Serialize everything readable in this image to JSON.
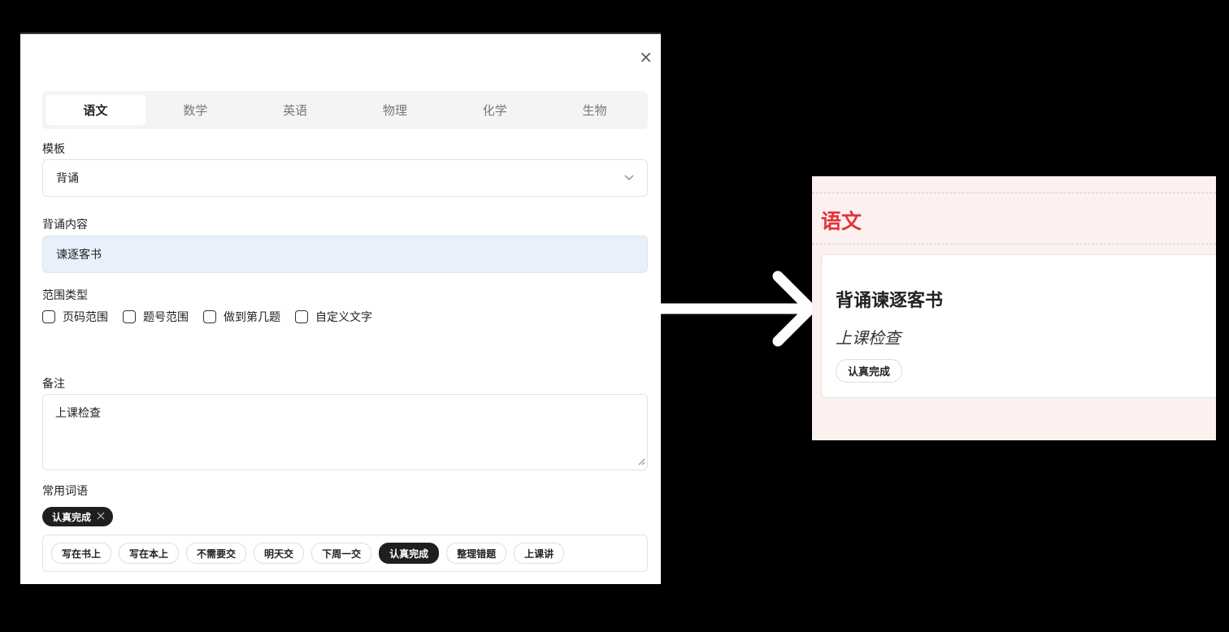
{
  "dialog": {
    "close_glyph": "×",
    "tabs": [
      {
        "label": "语文",
        "active": true
      },
      {
        "label": "数学",
        "active": false
      },
      {
        "label": "英语",
        "active": false
      },
      {
        "label": "物理",
        "active": false
      },
      {
        "label": "化学",
        "active": false
      },
      {
        "label": "生物",
        "active": false
      }
    ],
    "template_label": "模板",
    "template_value": "背诵",
    "content_label": "背诵内容",
    "content_value": "谏逐客书",
    "range_label": "范围类型",
    "range_options": [
      "页码范围",
      "题号范围",
      "做到第几题",
      "自定义文字"
    ],
    "note_label": "备注",
    "note_value": "上课检查",
    "phrases_label": "常用词语",
    "selected_phrase": "认真完成",
    "phrases": [
      {
        "label": "写在书上",
        "selected": false
      },
      {
        "label": "写在本上",
        "selected": false
      },
      {
        "label": "不需要交",
        "selected": false
      },
      {
        "label": "明天交",
        "selected": false
      },
      {
        "label": "下周一交",
        "selected": false
      },
      {
        "label": "认真完成",
        "selected": true
      },
      {
        "label": "整理错题",
        "selected": false
      },
      {
        "label": "上课讲",
        "selected": false
      }
    ]
  },
  "preview": {
    "subject": "语文",
    "title": "背诵谏逐客书",
    "note": "上课检查",
    "tag": "认真完成",
    "subject_color": "#e2343b",
    "background": "#fdf1ef"
  }
}
